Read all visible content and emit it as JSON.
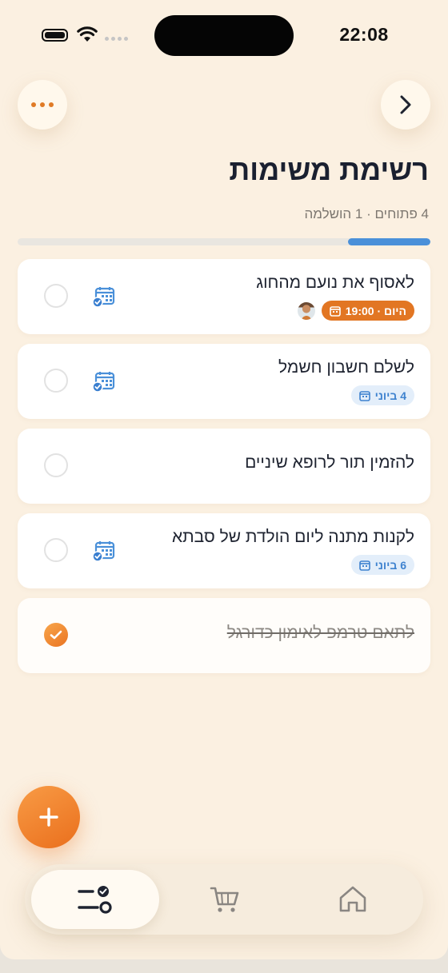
{
  "status_bar": {
    "time": "22:08"
  },
  "header": {
    "title": "רשימת משימות",
    "subtitle": "4 פתוחים · 1 הושלמה",
    "progress_fraction": 0.2
  },
  "tasks": [
    {
      "title": "לאסוף את נועם מהחוג",
      "chip": "היום · 19:00",
      "chip_style": "orange",
      "has_avatar": true,
      "has_calendar_icon": true,
      "completed": false
    },
    {
      "title": "לשלם חשבון חשמל",
      "chip": "4 ביוני",
      "chip_style": "blue",
      "has_calendar_icon": true,
      "completed": false
    },
    {
      "title": "להזמין תור לרופא שיניים",
      "completed": false
    },
    {
      "title": "לקנות מתנה ליום הולדת של סבתא",
      "chip": "6 ביוני",
      "chip_style": "blue",
      "has_calendar_icon": true,
      "completed": false
    },
    {
      "title": "לתאם טרמפ לאימון כדורגל",
      "completed": true
    }
  ],
  "nav": {
    "items": [
      "tasks-icon",
      "cart-icon",
      "home-icon"
    ],
    "active": "tasks-icon"
  },
  "colors": {
    "accent": "#e27623",
    "blue": "#4a90d9",
    "background": "#fbf0e1"
  }
}
